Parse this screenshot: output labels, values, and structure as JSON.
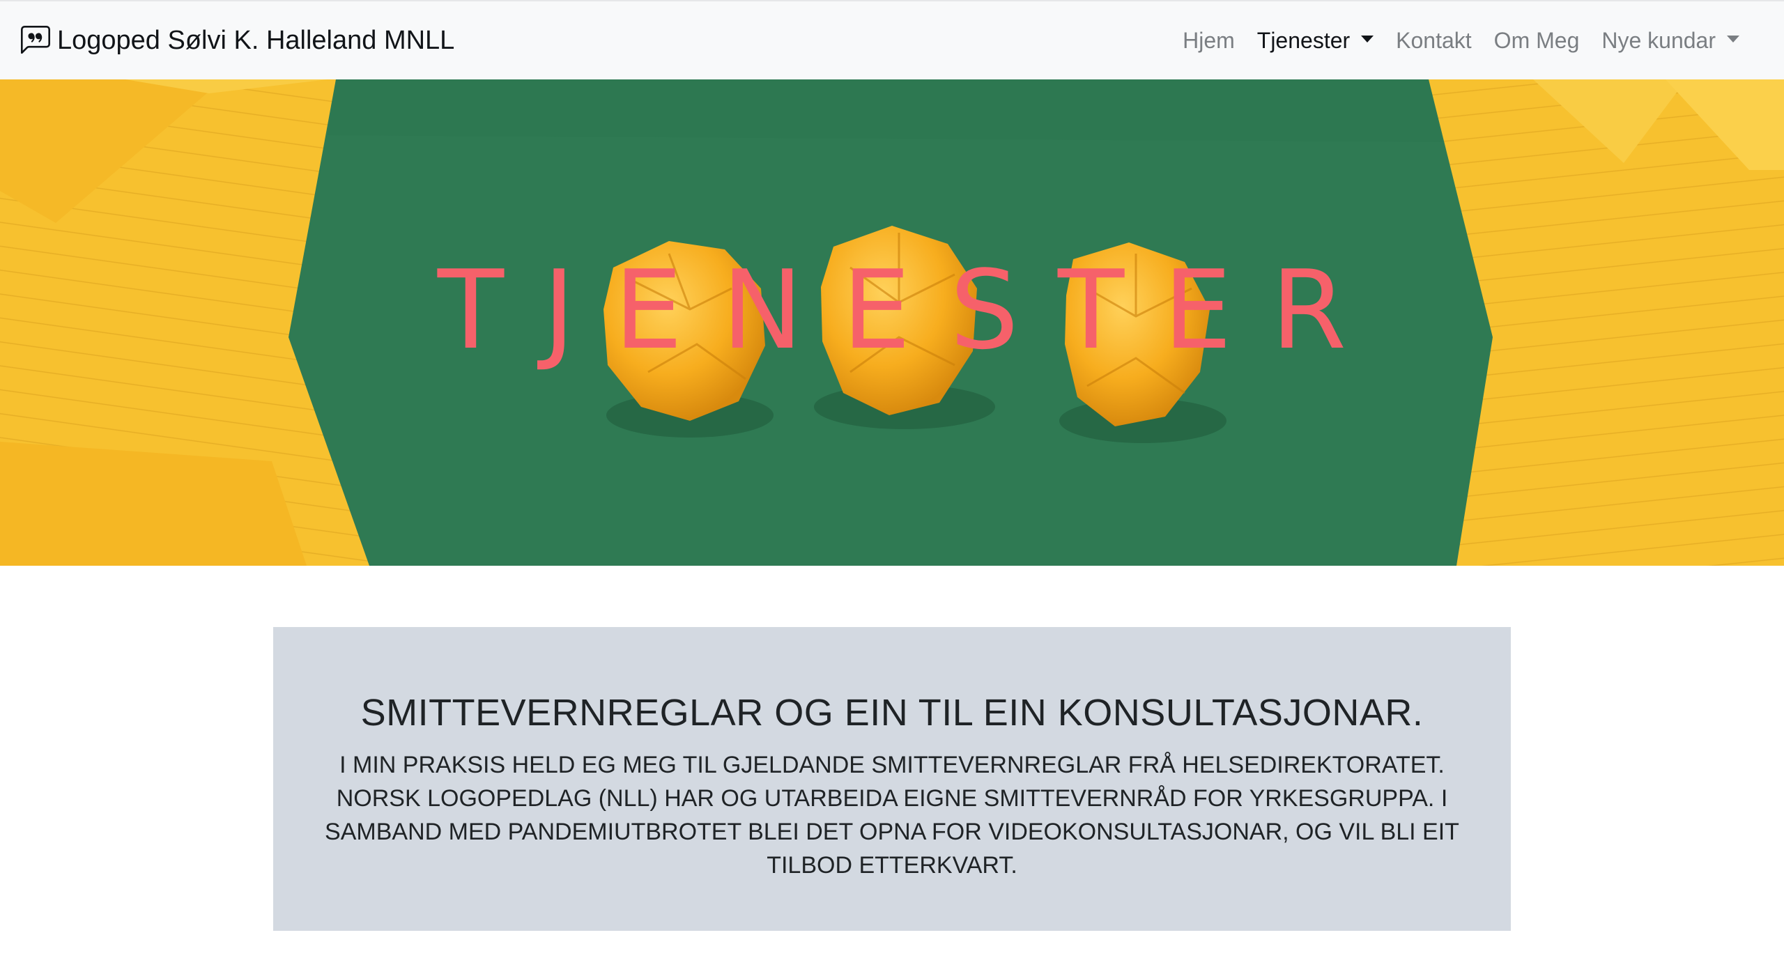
{
  "navbar": {
    "brand": "Logoped Sølvi K. Halleland MNLL",
    "brand_icon": "chat-quote-icon",
    "links": {
      "home": "Hjem",
      "services": "Tjenester",
      "contact": "Kontakt",
      "about": "Om Meg",
      "new_clients": "Nye kundar"
    },
    "active": "Tjenester"
  },
  "hero": {
    "title": "TJENESTER",
    "colors": {
      "title": "#f6616a",
      "board": "#2f7a53",
      "paper": "#f6bf2c"
    }
  },
  "notice": {
    "heading": "SMITTEVERNREGLAR OG EIN TIL EIN KONSULTASJONAR.",
    "body": "I MIN PRAKSIS HELD EG MEG TIL GJELDANDE SMITTEVERNREGLAR FRÅ HELSEDIREKTORATET. NORSK LOGOPEDLAG (NLL) HAR OG UTARBEIDA EIGNE SMITTEVERNRÅD FOR YRKESGRUPPA. I SAMBAND MED PANDEMIUTBROTET BLEI DET OPNA FOR VIDEOKONSULTASJONAR, OG VIL BLI EIT TILBOD ETTERKVART.",
    "background": "#d3d9e1"
  }
}
